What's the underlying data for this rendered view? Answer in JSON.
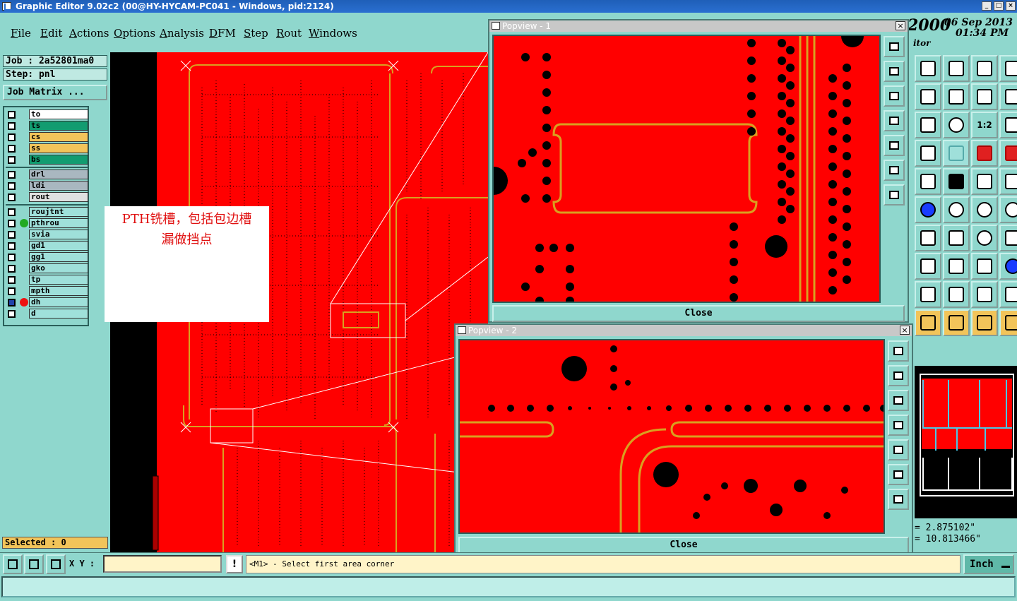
{
  "window": {
    "title": "Graphic Editor 9.02c2 (00@HY-HYCAM-PC041 - Windows, pid:2124)"
  },
  "menu": [
    "File",
    "Edit",
    "Actions",
    "Options",
    "Analysis",
    "DFM",
    "Step",
    "Rout",
    "Windows"
  ],
  "job": {
    "job_label": "Job : 2a52801ma0",
    "step_label": "Step: pnl",
    "matrix_button": "Job Matrix ..."
  },
  "layers": {
    "group1": [
      {
        "name": "to",
        "color": "#ffffff"
      },
      {
        "name": "ts",
        "color": "#129c70"
      },
      {
        "name": "cs",
        "color": "#f2c45a"
      },
      {
        "name": "ss",
        "color": "#f2c45a"
      },
      {
        "name": "bs",
        "color": "#129c70"
      }
    ],
    "group2": [
      {
        "name": "drl",
        "color": "#a9b7c0"
      },
      {
        "name": "ldi",
        "color": "#a9b7c0"
      },
      {
        "name": "rout",
        "color": "#e0e0e0"
      }
    ],
    "group3": [
      {
        "name": "roujtnt",
        "color": "#9fe0da",
        "indicator": null
      },
      {
        "name": "pthrou",
        "color": "#9fe0da",
        "indicator": "#22aa22"
      },
      {
        "name": "svia",
        "color": "#9fe0da",
        "indicator": null
      },
      {
        "name": "gd1",
        "color": "#9fe0da",
        "indicator": null
      },
      {
        "name": "gg1",
        "color": "#9fe0da",
        "indicator": null
      },
      {
        "name": "gko",
        "color": "#9fe0da",
        "indicator": null
      },
      {
        "name": "tp",
        "color": "#9fe0da",
        "indicator": null
      },
      {
        "name": "mpth",
        "color": "#9fe0da",
        "indicator": null
      },
      {
        "name": "dh",
        "color": "#9fe0da",
        "indicator": "#ee1111",
        "selected": true
      },
      {
        "name": "d",
        "color": "#9fe0da",
        "indicator": null
      }
    ]
  },
  "selected_label": "Selected : 0",
  "annotation": {
    "line1": "PTH铣槽，包括包边槽",
    "line2": "漏做挡点"
  },
  "popview1": {
    "title": "Popview - 1",
    "close_label": "Close"
  },
  "popview2": {
    "title": "Popview - 2",
    "close_label": "Close"
  },
  "header_right": {
    "year_fragment": "2000",
    "date": "06 Sep 2013",
    "time": "01:34 PM",
    "app_fragment": "itor"
  },
  "toolbox_labels": {
    "one_to_two": "1:2"
  },
  "coords": {
    "x": "= 2.875102\"",
    "y": "= 10.813466\""
  },
  "status": {
    "xy_label": "X Y :",
    "xy_value": "",
    "warn_label": "!",
    "message": "<M1> - Select first area corner",
    "unit": "Inch"
  },
  "colors": {
    "board": "#ff0000",
    "trace": "#d9a020",
    "panel": "#8fd7cd"
  }
}
